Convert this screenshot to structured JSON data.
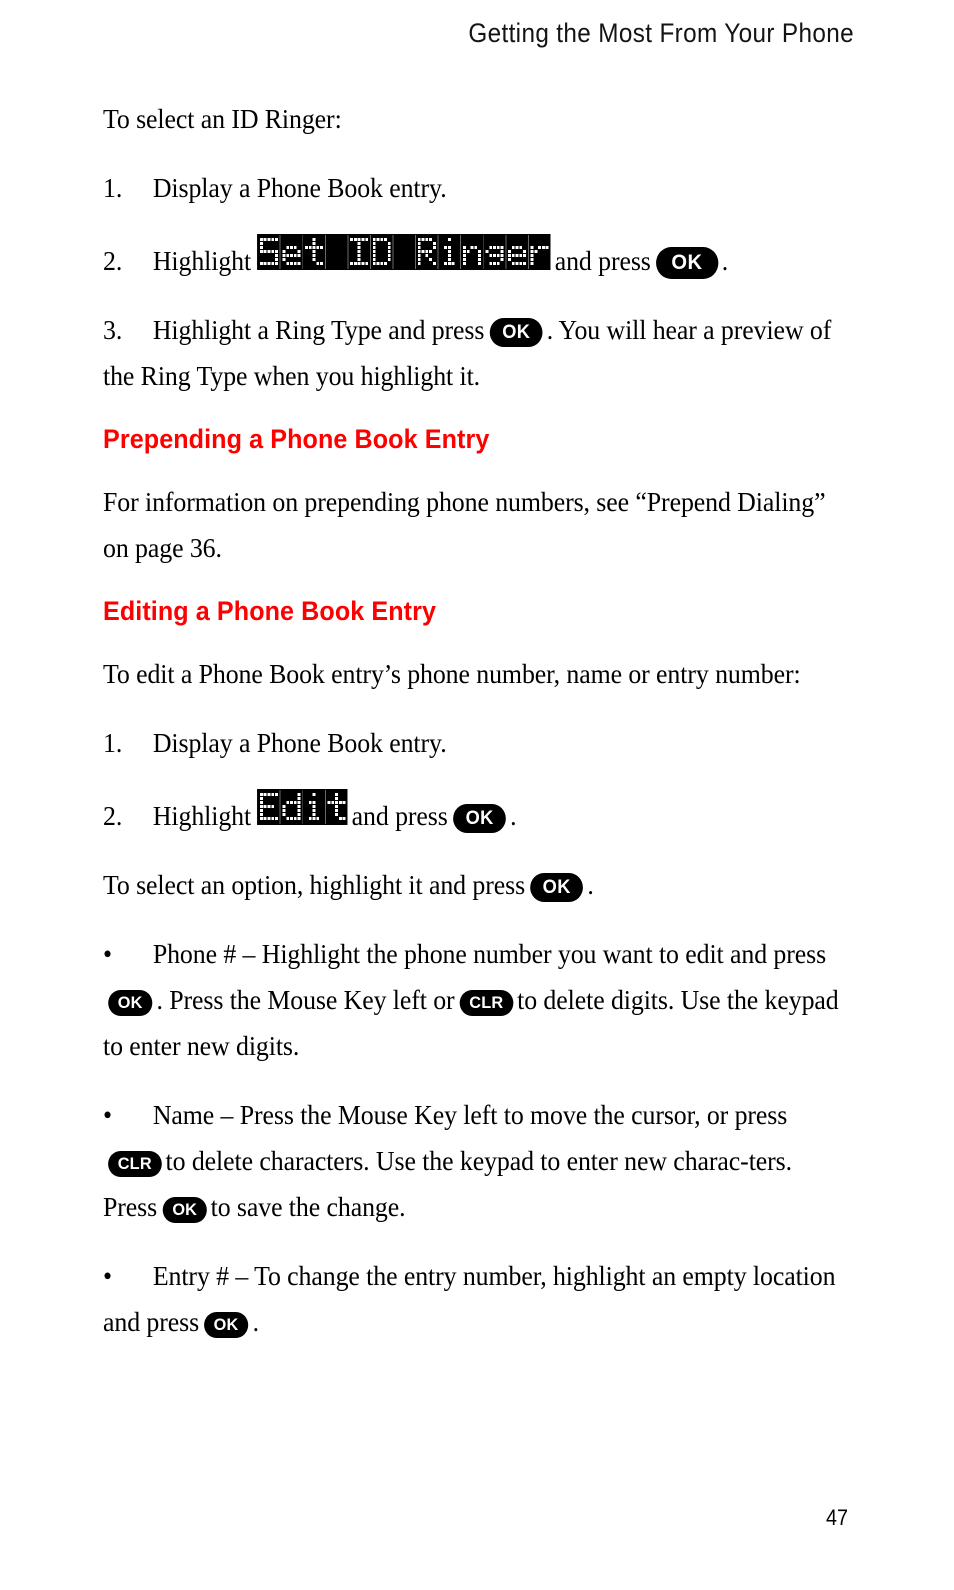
{
  "header": {
    "title": "Getting the Most From Your Phone"
  },
  "page_number": "47",
  "colors": {
    "heading_red": "#ff0000",
    "text_black": "#000000",
    "lcd_background": "#000000",
    "lcd_pixel": "#ffffff",
    "key_background": "#000000",
    "key_label": "#ffffff"
  },
  "keys": {
    "ok": "OK",
    "clr": "CLR"
  },
  "lcd_labels": {
    "set_id_ringer": "Set ID Ringer",
    "edit": "Edit"
  },
  "body": {
    "intro_line": "To select an ID Ringer:",
    "step1_number": "1.",
    "step1_text": "Display a Phone Book entry.",
    "step2_number": "2.",
    "step2_before": "Highlight",
    "step2_middle": "and press",
    "step2_after": ".",
    "step3_number": "3.",
    "step3_before": "Highlight a Ring Type and press",
    "step3_after": ". You will hear a preview of the Ring Type when you highlight it.",
    "heading_prepending": "Prepending a Phone Book Entry",
    "prepending_para": "For information on prepending phone numbers, see “Prepend Dialing” on page 36.",
    "heading_editing": "Editing a Phone Book Entry",
    "editing_intro": "To edit a Phone Book entry’s phone number, name or entry number:",
    "edit_step1_number": "1.",
    "edit_step1_text": "Display a Phone Book entry.",
    "edit_step2_number": "2.",
    "edit_step2_before": "Highlight",
    "edit_step2_middle": "and press",
    "edit_step2_after": ".",
    "select_option_before": "To select an option, highlight it and press",
    "select_option_after": ".",
    "bullet_marker": "•",
    "bullet1_before": "Phone # – Highlight the phone number you want to edit and press",
    "bullet1_mid1": ". Press the Mouse Key left or",
    "bullet1_mid2": "to delete digits. Use the keypad to enter new digits.",
    "bullet2_before": "Name – Press the Mouse Key left to move the cursor, or press",
    "bullet2_mid1": "to delete characters. Use the keypad to enter new charac-ters. Press",
    "bullet2_mid2": "to save the change.",
    "bullet3_before": "Entry # – To change the entry number, highlight an empty location and press",
    "bullet3_after": "."
  }
}
